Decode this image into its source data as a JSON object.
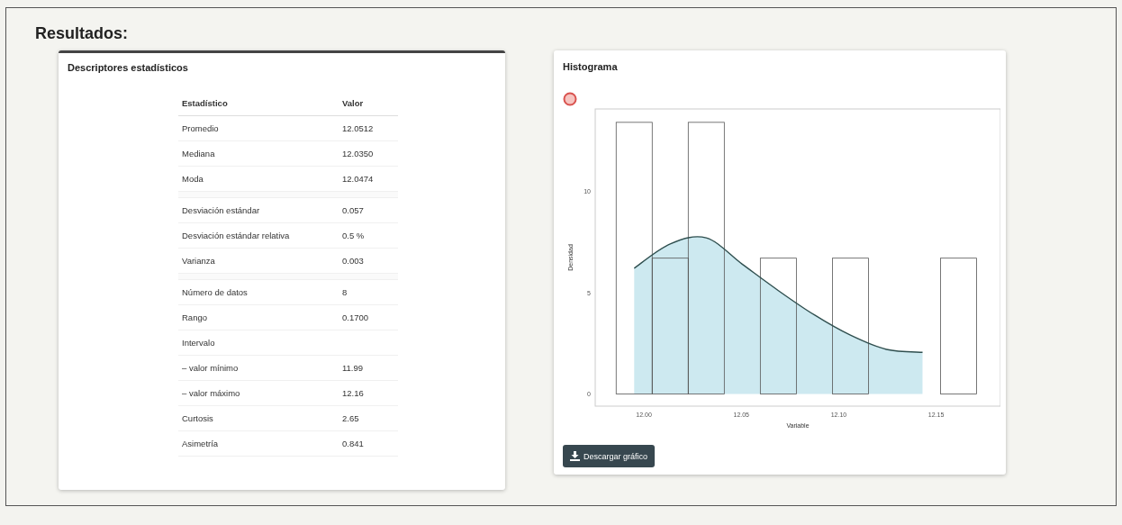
{
  "title": "Resultados:",
  "descriptors": {
    "title": "Descriptores estadísticos",
    "columns": [
      "Estadístico",
      "Valor"
    ],
    "groups": [
      [
        {
          "label": "Promedio",
          "value": "12.0512"
        },
        {
          "label": "Mediana",
          "value": "12.0350"
        },
        {
          "label": "Moda",
          "value": "12.0474"
        }
      ],
      [
        {
          "label": "Desviación estándar",
          "value": "0.057"
        },
        {
          "label": "Desviación estándar relativa",
          "value": "0.5 %"
        },
        {
          "label": "Varianza",
          "value": "0.003"
        }
      ],
      [
        {
          "label": "Número de datos",
          "value": "8"
        },
        {
          "label": "Rango",
          "value": "0.1700"
        },
        {
          "label": "Intervalo"
        },
        {
          "label": "– valor mínimo",
          "value": "11.99"
        },
        {
          "label": "– valor máximo",
          "value": "12.16"
        },
        {
          "label": "Curtosis",
          "value": "2.65"
        },
        {
          "label": "Asimetría",
          "value": "0.841"
        }
      ]
    ]
  },
  "histogram": {
    "title": "Histograma",
    "download_button": "Descargar gráfico",
    "chart_data": {
      "type": "bar",
      "xlabel": "Variable",
      "ylabel": "Densidad",
      "x": [
        11.995,
        12.0135,
        12.032,
        12.0505,
        12.069,
        12.0875,
        12.106,
        12.1245,
        12.143,
        12.1615
      ],
      "series": [
        {
          "type": "bar",
          "color": "#555555",
          "values": [
            13.4,
            6.7,
            13.4,
            0,
            6.7,
            0,
            6.7,
            0,
            0,
            6.7
          ]
        },
        {
          "type": "area",
          "color": "#cde9f0",
          "values": [
            6.2,
            7.4,
            7.7,
            6.4,
            5.1,
            3.9,
            2.9,
            2.2,
            2.05,
            null
          ]
        }
      ],
      "xlim": [
        11.975,
        12.183
      ],
      "ylim": [
        -0.6,
        14.06
      ],
      "xticks": [
        {
          "value": 12.0,
          "label": "12.00"
        },
        {
          "value": 12.05,
          "label": "12.05"
        },
        {
          "value": 12.1,
          "label": "12.10"
        },
        {
          "value": 12.15,
          "label": "12.15"
        }
      ],
      "yticks": [
        0,
        5,
        10
      ]
    }
  }
}
